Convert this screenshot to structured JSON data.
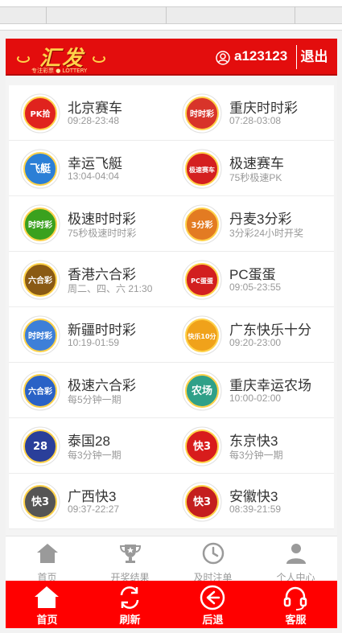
{
  "header": {
    "logo_text": "汇发",
    "logo_sub": "专注彩票 ● LOTTERY",
    "username": "a123123",
    "logout_label": "退出"
  },
  "lotteries": [
    {
      "name": "北京赛车",
      "time": "09:28-23:48",
      "icon_text": "PK拾",
      "icon": "pk10-icon",
      "color": "#e0231e"
    },
    {
      "name": "重庆时时彩",
      "time": "07:28-03:08",
      "icon_text": "时时彩",
      "icon": "ssc-icon",
      "color": "#d8342a"
    },
    {
      "name": "幸运飞艇",
      "time": "13:04-04:04",
      "icon_text": "飞艇",
      "icon": "airship-icon",
      "color": "#2b7fd6"
    },
    {
      "name": "极速赛车",
      "time": "75秒极速PK",
      "icon_text": "极速赛车",
      "icon": "speed-racing-icon",
      "color": "#d42020"
    },
    {
      "name": "极速时时彩",
      "time": "75秒极速时时彩",
      "icon_text": "时时彩",
      "icon": "speed-ssc-icon",
      "color": "#3aa11e"
    },
    {
      "name": "丹麦3分彩",
      "time": "3分彩24小时开奖",
      "icon_text": "3分彩",
      "icon": "denmark-3min-icon",
      "color": "#e37b22"
    },
    {
      "name": "香港六合彩",
      "time": "周二、四、六 21:30",
      "icon_text": "六合彩",
      "icon": "hk-marksix-icon",
      "color": "#8a5a14"
    },
    {
      "name": "PC蛋蛋",
      "time": "09:05-23:55",
      "icon_text": "PC蛋蛋",
      "icon": "pc-egg-icon",
      "color": "#d21f1f"
    },
    {
      "name": "新疆时时彩",
      "time": "10:19-01:59",
      "icon_text": "时时彩",
      "icon": "xinjiang-ssc-icon",
      "color": "#3d7fd8"
    },
    {
      "name": "广东快乐十分",
      "time": "09:20-23:00",
      "icon_text": "快乐10分",
      "icon": "gd-happy10-icon",
      "color": "#f0a21a"
    },
    {
      "name": "极速六合彩",
      "time": "每5分钟一期",
      "icon_text": "六合彩",
      "icon": "speed-marksix-icon",
      "color": "#2a62c6"
    },
    {
      "name": "重庆幸运农场",
      "time": "10:00-02:00",
      "icon_text": "农场",
      "icon": "cq-farm-icon",
      "color": "#2fa088"
    },
    {
      "name": "泰国28",
      "time": "每3分钟一期",
      "icon_text": "28",
      "icon": "thailand28-icon",
      "color": "#2a3f9a"
    },
    {
      "name": "东京快3",
      "time": "每3分钟一期",
      "icon_text": "快3",
      "icon": "tokyo-k3-icon",
      "color": "#d81c1c"
    },
    {
      "name": "广西快3",
      "time": "09:37-22:27",
      "icon_text": "快3",
      "icon": "guangxi-k3-icon",
      "color": "#555555"
    },
    {
      "name": "安徽快3",
      "time": "08:39-21:59",
      "icon_text": "快3",
      "icon": "anhui-k3-icon",
      "color": "#c41e1e"
    }
  ],
  "tabs": [
    {
      "label": "首页",
      "icon": "home-icon"
    },
    {
      "label": "开奖结果",
      "icon": "trophy-icon"
    },
    {
      "label": "及时注单",
      "icon": "clock-icon"
    },
    {
      "label": "个人中心",
      "icon": "person-icon"
    }
  ],
  "bottom_nav": [
    {
      "label": "首页",
      "icon": "home-icon"
    },
    {
      "label": "刷新",
      "icon": "refresh-icon"
    },
    {
      "label": "后退",
      "icon": "back-icon"
    },
    {
      "label": "客服",
      "icon": "headset-icon"
    }
  ],
  "colors": {
    "header_red": "#e30d0d",
    "bottom_red": "#ff0000",
    "tab_grey": "#9a9a9a"
  }
}
